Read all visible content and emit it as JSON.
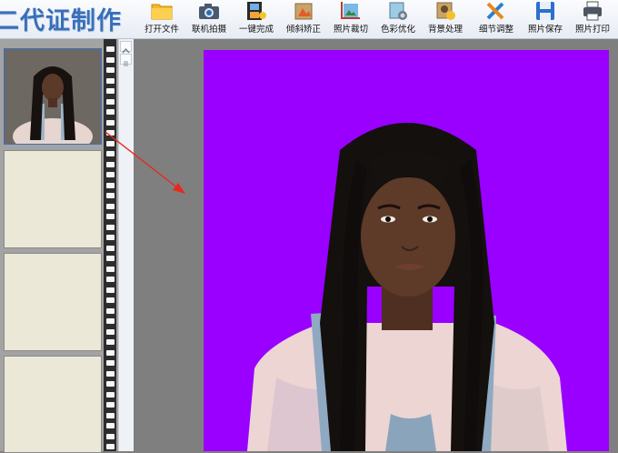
{
  "app": {
    "title": "二代证制作"
  },
  "toolbar": {
    "items": [
      {
        "label": "打开文件",
        "icon": "folder-icon"
      },
      {
        "label": "联机拍摄",
        "icon": "camera-icon"
      },
      {
        "label": "一键完成",
        "icon": "film-icon"
      },
      {
        "label": "倾斜矫正",
        "icon": "rotate-icon"
      },
      {
        "label": "照片裁切",
        "icon": "crop-icon"
      },
      {
        "label": "色彩优化",
        "icon": "color-icon"
      },
      {
        "label": "背景处理",
        "icon": "background-icon"
      },
      {
        "label": "细节调整",
        "icon": "tools-icon"
      },
      {
        "label": "照片保存",
        "icon": "save-icon"
      },
      {
        "label": "照片打印",
        "icon": "printer-icon"
      }
    ]
  },
  "colors": {
    "background_fill": "#9900ff",
    "title_blue": "#3a6fb8",
    "workspace": "#7f7f7f",
    "arrow": "#e8281e"
  }
}
